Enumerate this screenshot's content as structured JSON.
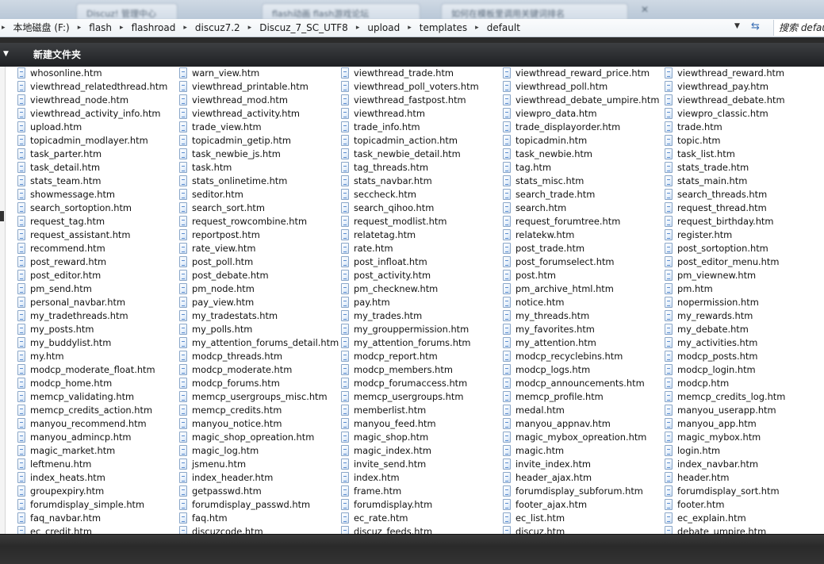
{
  "tabs": [
    {
      "label": "Discuz! 管理中心"
    },
    {
      "label": "flash动画 flash游戏论坛"
    },
    {
      "label": "如何在模板里调用关键词排名"
    }
  ],
  "address_bar": {
    "crumbs": [
      "本地磁盘 (F:)",
      "flash",
      "flashroad",
      "discuz7.2",
      "Discuz_7_SC_UTF8",
      "upload",
      "templates",
      "default"
    ],
    "search_text": "搜索 default"
  },
  "command_bar": {
    "new_folder_label": "新建文件夹"
  },
  "file_columns": [
    [
      "whosonline.htm",
      "viewthread_relatedthread.htm",
      "viewthread_node.htm",
      "viewthread_activity_info.htm",
      "upload.htm",
      "topicadmin_modlayer.htm",
      "task_parter.htm",
      "task_detail.htm",
      "stats_team.htm",
      "showmessage.htm",
      "search_sortoption.htm",
      "request_tag.htm",
      "request_assistant.htm",
      "recommend.htm",
      "post_reward.htm",
      "post_editor.htm",
      "pm_send.htm",
      "personal_navbar.htm",
      "my_tradethreads.htm",
      "my_posts.htm",
      "my_buddylist.htm",
      "my.htm",
      "modcp_moderate_float.htm",
      "modcp_home.htm",
      "memcp_validating.htm",
      "memcp_credits_action.htm",
      "manyou_recommend.htm",
      "manyou_admincp.htm",
      "magic_market.htm",
      "leftmenu.htm",
      "index_heats.htm",
      "groupexpiry.htm",
      "forumdisplay_simple.htm",
      "faq_navbar.htm",
      "ec_credit.htm"
    ],
    [
      "warn_view.htm",
      "viewthread_printable.htm",
      "viewthread_mod.htm",
      "viewthread_activity.htm",
      "trade_view.htm",
      "topicadmin_getip.htm",
      "task_newbie_js.htm",
      "task.htm",
      "stats_onlinetime.htm",
      "seditor.htm",
      "search_sort.htm",
      "request_rowcombine.htm",
      "reportpost.htm",
      "rate_view.htm",
      "post_poll.htm",
      "post_debate.htm",
      "pm_node.htm",
      "pay_view.htm",
      "my_tradestats.htm",
      "my_polls.htm",
      "my_attention_forums_detail.htm",
      "modcp_threads.htm",
      "modcp_moderate.htm",
      "modcp_forums.htm",
      "memcp_usergroups_misc.htm",
      "memcp_credits.htm",
      "manyou_notice.htm",
      "magic_shop_opreation.htm",
      "magic_log.htm",
      "jsmenu.htm",
      "index_header.htm",
      "getpasswd.htm",
      "forumdisplay_passwd.htm",
      "faq.htm",
      "discuzcode.htm"
    ],
    [
      "viewthread_trade.htm",
      "viewthread_poll_voters.htm",
      "viewthread_fastpost.htm",
      "viewthread.htm",
      "trade_info.htm",
      "topicadmin_action.htm",
      "task_newbie_detail.htm",
      "tag_threads.htm",
      "stats_navbar.htm",
      "seccheck.htm",
      "search_qihoo.htm",
      "request_modlist.htm",
      "relatetag.htm",
      "rate.htm",
      "post_infloat.htm",
      "post_activity.htm",
      "pm_checknew.htm",
      "pay.htm",
      "my_trades.htm",
      "my_grouppermission.htm",
      "my_attention_forums.htm",
      "modcp_report.htm",
      "modcp_members.htm",
      "modcp_forumaccess.htm",
      "memcp_usergroups.htm",
      "memberlist.htm",
      "manyou_feed.htm",
      "magic_shop.htm",
      "magic_index.htm",
      "invite_send.htm",
      "index.htm",
      "frame.htm",
      "forumdisplay.htm",
      "ec_rate.htm",
      "discuz_feeds.htm"
    ],
    [
      "viewthread_reward_price.htm",
      "viewthread_poll.htm",
      "viewthread_debate_umpire.htm",
      "viewpro_data.htm",
      "trade_displayorder.htm",
      "topicadmin.htm",
      "task_newbie.htm",
      "tag.htm",
      "stats_misc.htm",
      "search_trade.htm",
      "search.htm",
      "request_forumtree.htm",
      "relatekw.htm",
      "post_trade.htm",
      "post_forumselect.htm",
      "post.htm",
      "pm_archive_html.htm",
      "notice.htm",
      "my_threads.htm",
      "my_favorites.htm",
      "my_attention.htm",
      "modcp_recyclebins.htm",
      "modcp_logs.htm",
      "modcp_announcements.htm",
      "memcp_profile.htm",
      "medal.htm",
      "manyou_appnav.htm",
      "magic_mybox_opreation.htm",
      "magic.htm",
      "invite_index.htm",
      "header_ajax.htm",
      "forumdisplay_subforum.htm",
      "footer_ajax.htm",
      "ec_list.htm",
      "discuz.htm"
    ],
    [
      "viewthread_reward.htm",
      "viewthread_pay.htm",
      "viewthread_debate.htm",
      "viewpro_classic.htm",
      "trade.htm",
      "topic.htm",
      "task_list.htm",
      "stats_trade.htm",
      "stats_main.htm",
      "search_threads.htm",
      "request_thread.htm",
      "request_birthday.htm",
      "register.htm",
      "post_sortoption.htm",
      "post_editor_menu.htm",
      "pm_viewnew.htm",
      "pm.htm",
      "nopermission.htm",
      "my_rewards.htm",
      "my_debate.htm",
      "my_activities.htm",
      "modcp_posts.htm",
      "modcp_login.htm",
      "modcp.htm",
      "memcp_credits_log.htm",
      "manyou_userapp.htm",
      "manyou_app.htm",
      "magic_mybox.htm",
      "login.htm",
      "index_navbar.htm",
      "header.htm",
      "forumdisplay_sort.htm",
      "footer.htm",
      "ec_explain.htm",
      "debate_umpire.htm"
    ]
  ],
  "icons": {
    "file": "htm-file-icon",
    "nav_dropdown": "chevron-down-icon",
    "refresh": "refresh-icon"
  }
}
